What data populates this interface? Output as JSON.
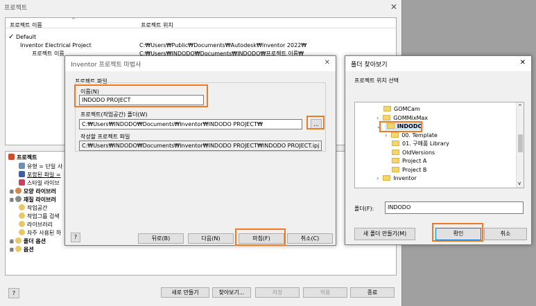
{
  "projects_window": {
    "title": "프로젝트",
    "col_name": "프로젝트 이름",
    "col_location": "프로젝트 위치",
    "rows": [
      {
        "name": "Default",
        "location": "",
        "check": "✓"
      },
      {
        "name": "Inventor Electrical Project",
        "location": "C:₩Users₩Public₩Documents₩Autodesk₩Inventor 2022₩"
      },
      {
        "name": "프로젝트 이름",
        "location": "C:₩Users₩INDODO₩Documents₩INDODO₩프로젝트 이름₩"
      }
    ],
    "tree": [
      "프로젝트",
      "유형 = 단일 사",
      "포함된 파일 =",
      "스타일 라이브",
      "모양 라이브러",
      "재질 라이브러",
      "작업공간",
      "작업그룹 검색",
      "라이브러리",
      "자주 사용된 하",
      "폴더 옵션",
      "옵션"
    ],
    "buttons": {
      "new": "새로 만들기",
      "browse": "찾아보기...",
      "save": "저장",
      "apply": "적용",
      "done": "종료"
    },
    "help": "?"
  },
  "wizard": {
    "title": "Inventor 프로젝트 마법사",
    "section_label": "프로젝트 파일",
    "name_label": "이름(N)",
    "name_value": "INDODO PROJECT",
    "folder_label": "프로젝트(작업공간) 폴더(W)",
    "folder_value": "C:₩Users₩INDODO₩Documents₩Inventor₩INDODO PROJECT₩",
    "browse_label": "...",
    "file_label": "작성할 프로젝트 파일",
    "file_value": "C:₩Users₩INDODO₩Documents₩Inventor₩INDODO PROJECT₩INDODO PROJECT.ipj",
    "buttons": {
      "back": "뒤로(B)",
      "next": "다음(N)",
      "finish": "마침(F)",
      "cancel": "취소(C)"
    },
    "help": "?",
    "close": "✕"
  },
  "folder_dialog": {
    "title": "폴더 찾아보기",
    "instruction": "프로젝트 위치 선택",
    "tree": [
      {
        "label": "GOMCam",
        "level": 1,
        "expander": ""
      },
      {
        "label": "GOMMixMax",
        "level": 1,
        "expander": "›"
      },
      {
        "label": "INDODO",
        "level": 1,
        "expander": "⌄",
        "selected": true
      },
      {
        "label": "00. Template",
        "level": 2,
        "expander": "›"
      },
      {
        "label": "01. 구매품 Library",
        "level": 2,
        "expander": ""
      },
      {
        "label": "OldVersions",
        "level": 2,
        "expander": ""
      },
      {
        "label": "Project A",
        "level": 2,
        "expander": ""
      },
      {
        "label": "Project B",
        "level": 2,
        "expander": ""
      },
      {
        "label": "Inventor",
        "level": 1,
        "expander": "›"
      }
    ],
    "folder_label": "폴더(F):",
    "folder_value": "INDODO",
    "buttons": {
      "new_folder": "새 폴더 만들기(M)",
      "ok": "확인",
      "cancel": "취소"
    },
    "close": "✕"
  },
  "colors": {
    "highlight": "#f07a24",
    "selection": "#cce8ff",
    "folder": "#f5d46e"
  }
}
